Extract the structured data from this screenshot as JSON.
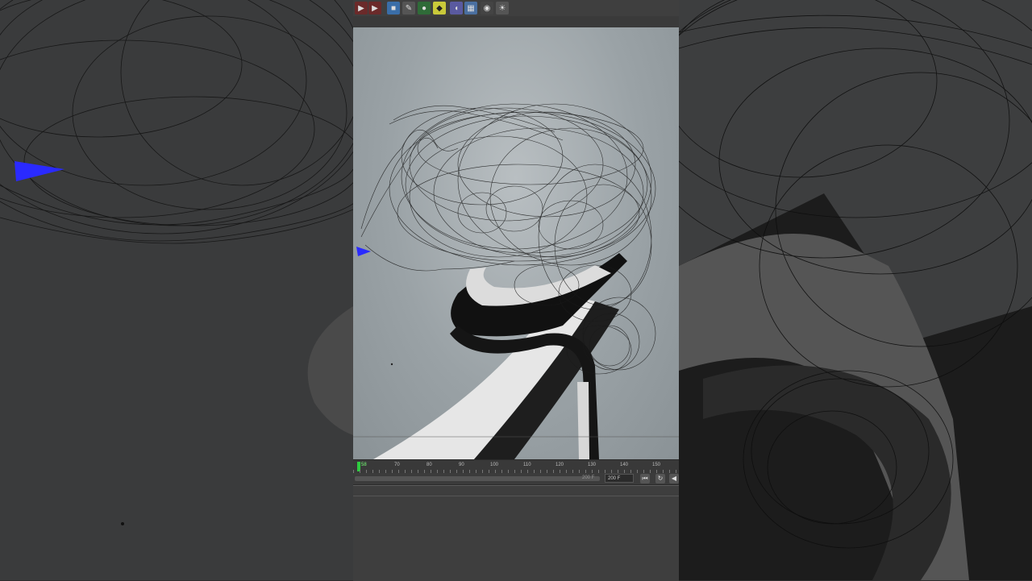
{
  "toolbar": {
    "icons": [
      "render-view-icon",
      "render-settings-icon",
      "cube-icon",
      "pen-icon",
      "subdivision-icon",
      "cloner-icon",
      "deformer-icon",
      "floor-icon",
      "camera-icon",
      "light-icon"
    ]
  },
  "timeline": {
    "current_frame": "58",
    "ticks": [
      "70",
      "80",
      "90",
      "100",
      "110",
      "120",
      "130",
      "140",
      "150"
    ]
  },
  "controls": {
    "range_end": "200 F",
    "end_frame": "200 F"
  },
  "colors": {
    "accent_green": "#2ecc40",
    "viewport_bg": "#a4abae",
    "wire": "#1a1a1a",
    "marker": "#2a2aff"
  }
}
